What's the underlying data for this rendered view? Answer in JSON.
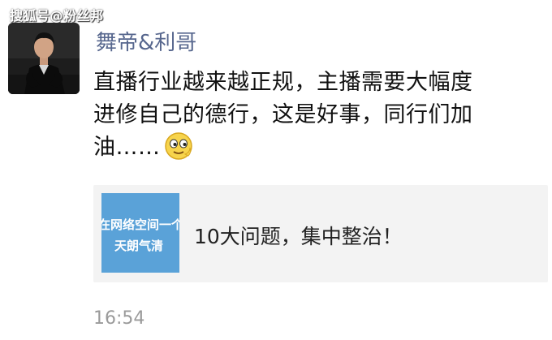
{
  "watermark": "搜狐号@粉丝邦",
  "post": {
    "author": "舞帝&利哥",
    "text_line1": "直播行业越来越正规，主播需要大幅度",
    "text_line2": "进修自己的德行，这是好事，同行们加",
    "text_line3": "油……",
    "emoji": "sly-smile-emoji",
    "share": {
      "thumb_line1": "在网络空间一个",
      "thumb_line2": "天朗气清",
      "title": "10大问题，集中整治！"
    },
    "timestamp": "16:54"
  },
  "colors": {
    "author": "#57678e",
    "thumb_bg": "#5aa2d8",
    "card_bg": "#f3f3f3",
    "timestamp": "#9a9a9a"
  }
}
